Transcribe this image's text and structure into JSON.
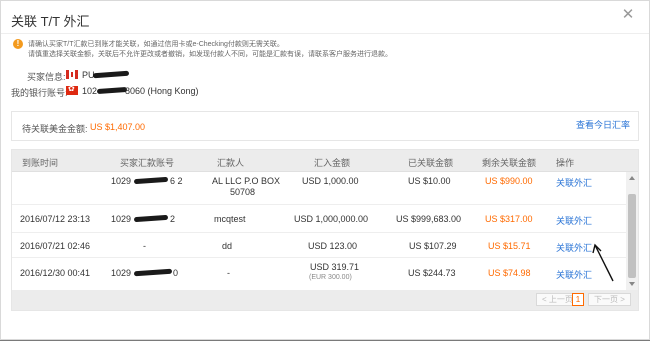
{
  "dialog": {
    "title": "关联 T/T 外汇",
    "close_icon": "close-icon"
  },
  "notice": {
    "icon": "warning-icon",
    "line1": "请确认买家T/T汇款已到账才能关联，如通过信用卡或e-Checking付款则无需关联。",
    "line2": "请慎重选择关联金额，关联后不允许更改或者撤销，如发现付款人不同，可能是汇款有误，请联系客户服务进行退款。"
  },
  "buyer": {
    "label": "买家信息:",
    "flag": "canada-flag",
    "value": "PU"
  },
  "bank": {
    "label": "我的银行账号:",
    "flag": "hong-kong-flag",
    "value_prefix": "102",
    "value_suffix": "8060  (Hong Kong)"
  },
  "pending": {
    "label": "待关联美金金额:",
    "amount": "US $1,407.00",
    "rate_link": "查看今日汇率"
  },
  "table": {
    "headers": [
      "到账时间",
      "买家汇款账号",
      "汇款人",
      "汇入金额",
      "已关联金额",
      "剩余关联金额",
      "操作"
    ],
    "rows": [
      {
        "time": "",
        "account_prefix": "1029",
        "account_suffix": "6 2",
        "remitter": "AL LLC P.O BOX",
        "remitter2": "50708",
        "amount": "USD 1,000.00",
        "amount_sub": "",
        "linked": "US $10.00",
        "remaining": "US $990.00",
        "action": "关联外汇"
      },
      {
        "time": "2016/07/12 23:13",
        "account_prefix": "1029",
        "account_suffix": "2",
        "remitter": "mcqtest",
        "remitter2": "",
        "amount": "USD 1,000,000.00",
        "amount_sub": "",
        "linked": "US $999,683.00",
        "remaining": "US $317.00",
        "action": "关联外汇"
      },
      {
        "time": "2016/07/21 02:46",
        "account_prefix": "-",
        "account_suffix": "",
        "remitter": "dd",
        "remitter2": "",
        "amount": "USD 123.00",
        "amount_sub": "",
        "linked": "US $107.29",
        "remaining": "US $15.71",
        "action": "关联外汇"
      },
      {
        "time": "2016/12/30 00:41",
        "account_prefix": "1029",
        "account_suffix": "0",
        "remitter": "-",
        "remitter2": "",
        "amount": "USD 319.71",
        "amount_sub": "(EUR 300.00)",
        "linked": "US $244.73",
        "remaining": "US $74.98",
        "action": "关联外汇"
      }
    ]
  },
  "pager": {
    "prev": "< 上一页",
    "current": "1",
    "next": "下一页 >"
  },
  "colors": {
    "accent_orange": "#ff6a00",
    "link_blue": "#2a74d6",
    "warning": "#f39a1e"
  }
}
